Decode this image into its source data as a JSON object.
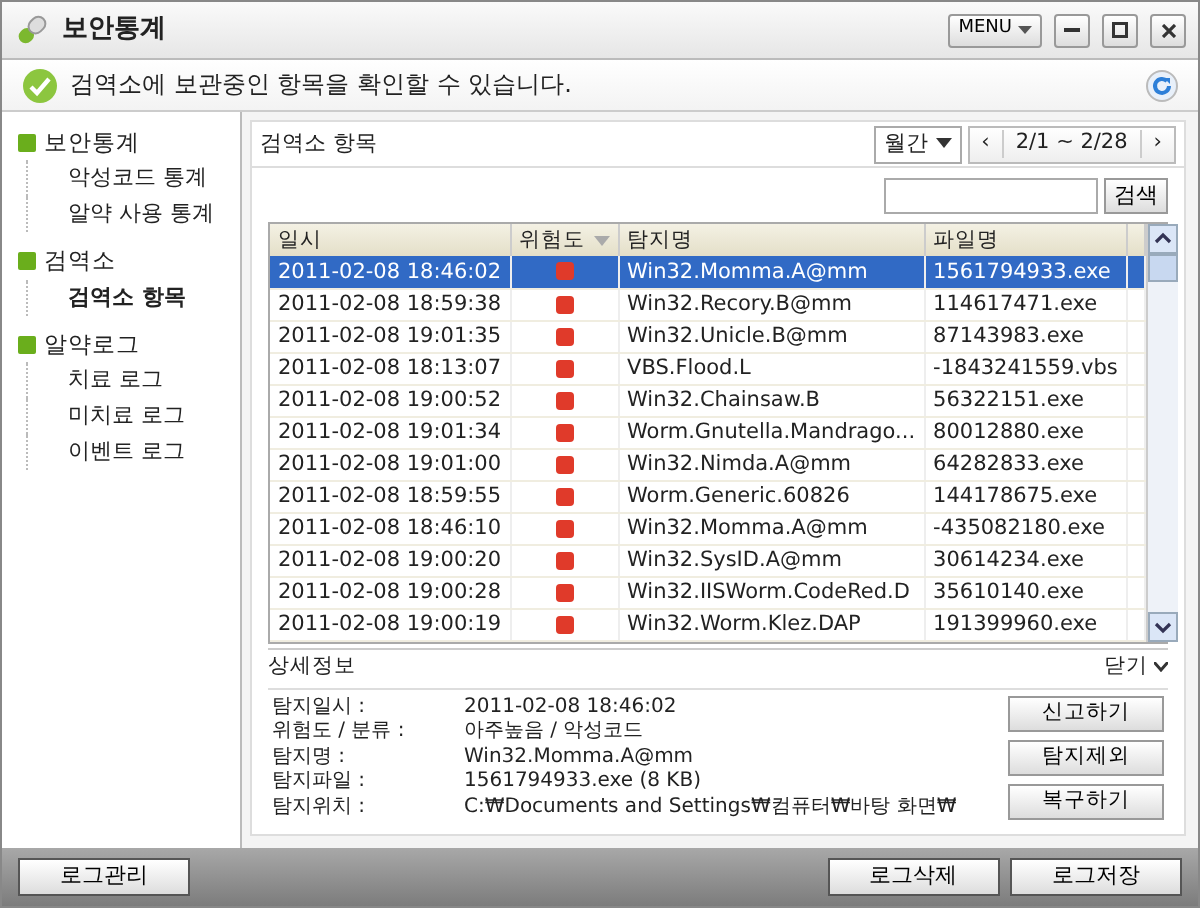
{
  "window": {
    "title": "보안통계",
    "menu_button": "MENU"
  },
  "message": "검역소에 보관중인 항목을 확인할 수 있습니다.",
  "sidebar": [
    {
      "label": "보안통계",
      "children": [
        {
          "label": "악성코드 통계",
          "selected": false
        },
        {
          "label": "알약 사용 통계",
          "selected": false
        }
      ]
    },
    {
      "label": "검역소",
      "children": [
        {
          "label": "검역소 항목",
          "selected": true
        }
      ]
    },
    {
      "label": "알약로그",
      "children": [
        {
          "label": "치료 로그",
          "selected": false
        },
        {
          "label": "미치료 로그",
          "selected": false
        },
        {
          "label": "이벤트 로그",
          "selected": false
        }
      ]
    }
  ],
  "panel": {
    "title": "검역소 항목",
    "period": "월간",
    "range": "2/1 ~ 2/28",
    "prev": "‹",
    "next": "›"
  },
  "search": {
    "button": "검색"
  },
  "table": {
    "columns": [
      "일시",
      "위험도",
      "탐지명",
      "파일명"
    ],
    "rows": [
      {
        "time": "2011-02-08 18:46:02",
        "name": "Win32.Momma.A@mm",
        "file": "1561794933.exe",
        "selected": true
      },
      {
        "time": "2011-02-08 18:59:38",
        "name": "Win32.Recory.B@mm",
        "file": "114617471.exe",
        "selected": false
      },
      {
        "time": "2011-02-08 19:01:35",
        "name": "Win32.Unicle.B@mm",
        "file": "87143983.exe",
        "selected": false
      },
      {
        "time": "2011-02-08 18:13:07",
        "name": "VBS.Flood.L",
        "file": "-1843241559.vbs",
        "selected": false
      },
      {
        "time": "2011-02-08 19:00:52",
        "name": "Win32.Chainsaw.B",
        "file": "56322151.exe",
        "selected": false
      },
      {
        "time": "2011-02-08 19:01:34",
        "name": "Worm.Gnutella.Mandrago...",
        "file": "80012880.exe",
        "selected": false
      },
      {
        "time": "2011-02-08 19:01:00",
        "name": "Win32.Nimda.A@mm",
        "file": "64282833.exe",
        "selected": false
      },
      {
        "time": "2011-02-08 18:59:55",
        "name": "Worm.Generic.60826",
        "file": "144178675.exe",
        "selected": false
      },
      {
        "time": "2011-02-08 18:46:10",
        "name": "Win32.Momma.A@mm",
        "file": "-435082180.exe",
        "selected": false
      },
      {
        "time": "2011-02-08 19:00:20",
        "name": "Win32.SysID.A@mm",
        "file": "30614234.exe",
        "selected": false
      },
      {
        "time": "2011-02-08 19:00:28",
        "name": "Win32.IISWorm.CodeRed.D",
        "file": "35610140.exe",
        "selected": false
      },
      {
        "time": "2011-02-08 19:00:19",
        "name": "Win32.Worm.Klez.DAP",
        "file": "191399960.exe",
        "selected": false
      }
    ]
  },
  "details": {
    "title": "상세정보",
    "close": "닫기",
    "fields": [
      {
        "label": "탐지일시 :",
        "value": "2011-02-08 18:46:02"
      },
      {
        "label": "위험도 / 분류 :",
        "value": "아주높음 / 악성코드"
      },
      {
        "label": "탐지명 :",
        "value": "Win32.Momma.A@mm"
      },
      {
        "label": "탐지파일 :",
        "value": "1561794933.exe (8 KB)"
      },
      {
        "label": "탐지위치 :",
        "value": "C:₩Documents and Settings₩컴퓨터₩바탕 화면₩"
      }
    ],
    "buttons": [
      "신고하기",
      "탐지제외",
      "복구하기"
    ]
  },
  "footer": {
    "left": "로그관리",
    "right": [
      "로그삭제",
      "로그저장"
    ]
  }
}
